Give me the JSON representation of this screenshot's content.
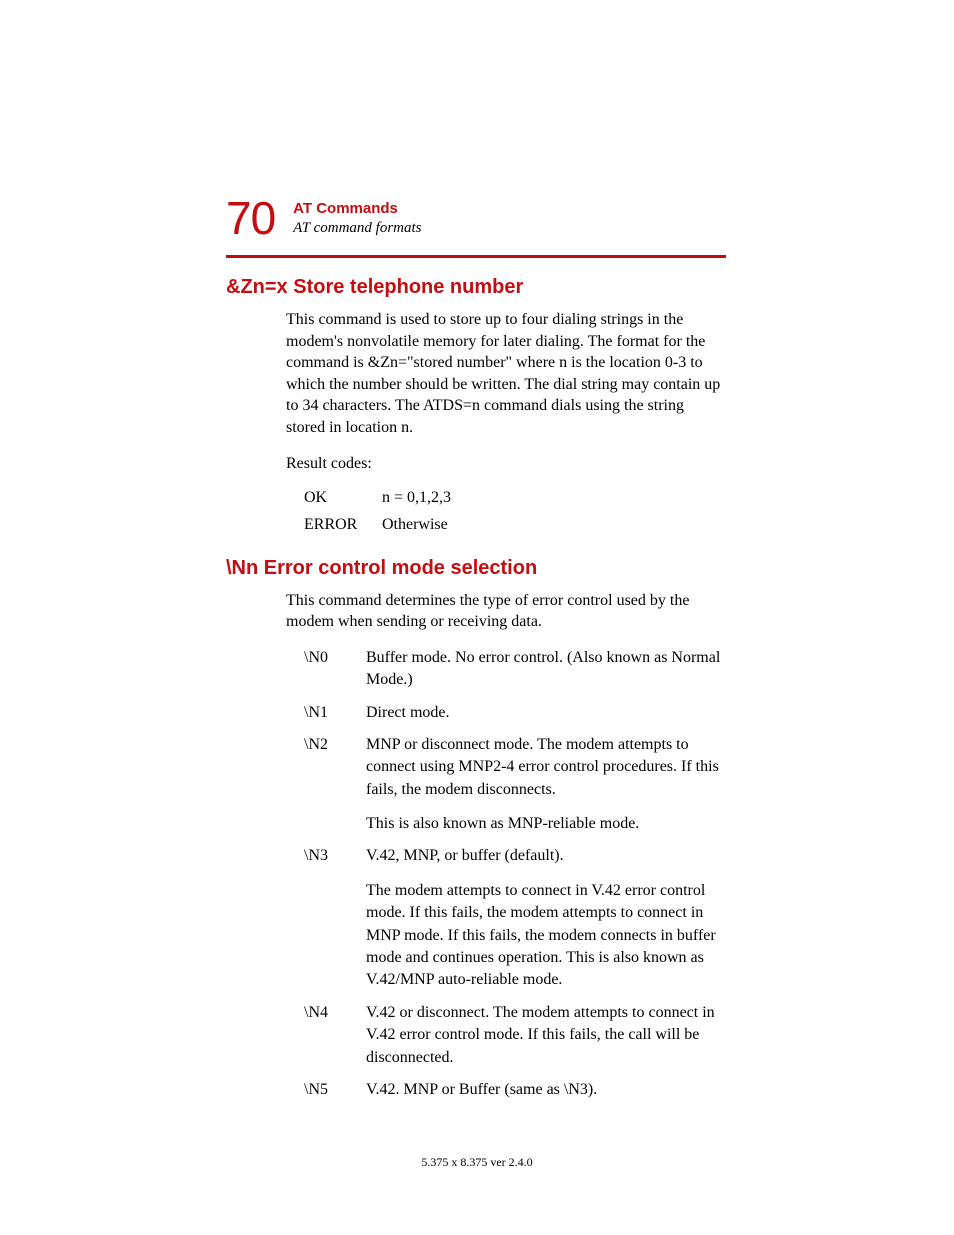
{
  "header": {
    "page_number": "70",
    "chapter": "AT Commands",
    "subtitle": "AT command formats"
  },
  "section1": {
    "heading": "&Zn=x Store telephone number",
    "para1": "This command is used to store up to four dialing strings in the modem's nonvolatile memory for later dialing. The format for the command is &Zn=\"stored number\" where n is the location 0-3 to which the number should be written. The dial string may contain up to 34 characters. The ATDS=n command dials using the string stored in location n.",
    "para2": "Result codes:",
    "codes": [
      {
        "k": "OK",
        "v": "n = 0,1,2,3"
      },
      {
        "k": "ERROR",
        "v": "Otherwise"
      }
    ]
  },
  "section2": {
    "heading": "\\Nn Error control mode selection",
    "para1": "This command determines the type of error control used by the modem when sending or receiving data.",
    "options": [
      {
        "k": "\\N0",
        "p1": "Buffer mode. No error control. (Also known as Normal Mode.)"
      },
      {
        "k": "\\N1",
        "p1": "Direct mode."
      },
      {
        "k": "\\N2",
        "p1": "MNP or disconnect mode. The modem attempts to connect using MNP2-4 error control procedures. If this fails, the modem disconnects.",
        "p2": "This is also known as MNP-reliable mode."
      },
      {
        "k": "\\N3",
        "p1": "V.42, MNP, or buffer (default).",
        "p2": "The modem attempts to connect in V.42 error control mode. If this fails, the modem attempts to connect in MNP mode. If this fails, the modem connects in buffer mode and continues operation. This is also known as V.42/MNP auto-reliable mode."
      },
      {
        "k": "\\N4",
        "p1": "V.42 or disconnect. The modem attempts to connect in V.42 error control mode. If this fails, the call will be disconnected."
      },
      {
        "k": "\\N5",
        "p1": "V.42. MNP or Buffer (same as \\N3)."
      }
    ]
  },
  "footer": "5.375 x 8.375 ver 2.4.0"
}
